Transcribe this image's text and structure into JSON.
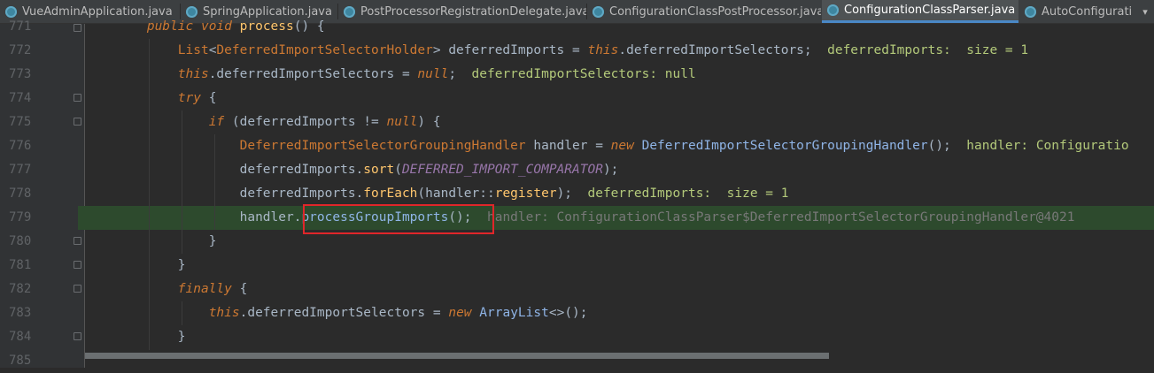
{
  "tabs": [
    {
      "label": "VueAdminApplication.java",
      "active": false,
      "closable": true
    },
    {
      "label": "SpringApplication.java",
      "active": false,
      "closable": true
    },
    {
      "label": "PostProcessorRegistrationDelegate.java",
      "active": false,
      "closable": true
    },
    {
      "label": "ConfigurationClassPostProcessor.java",
      "active": false,
      "closable": true
    },
    {
      "label": "ConfigurationClassParser.java",
      "active": true,
      "closable": true
    },
    {
      "label": "AutoConfigurati",
      "active": false,
      "closable": false
    }
  ],
  "tab_close_glyph": "×",
  "tab_overflow_glyph": "▾",
  "line_numbers": [
    "771",
    "772",
    "773",
    "774",
    "775",
    "776",
    "777",
    "778",
    "779",
    "780",
    "781",
    "782",
    "783",
    "784",
    "785"
  ],
  "code": {
    "l771": {
      "kw1": "public",
      "kw2": "void",
      "mth": "process",
      "rest": "() {"
    },
    "l772": {
      "kw": "List",
      "lt": "<",
      "type": "DeferredImportSelectorHolder",
      "gt": ">",
      "var": " deferredImports = ",
      "this": "this",
      "dot": ".",
      "fld": "deferredImportSelectors",
      "semi": ";",
      "inlay_name": "  deferredImports:",
      "inlay_size": "  size = ",
      "inlay_num": "1"
    },
    "l773": {
      "this": "this",
      "dot": ".",
      "fld": "deferredImportSelectors",
      "eq": " = ",
      "null": "null",
      "semi": ";",
      "inlay": "  deferredImportSelectors: null"
    },
    "l774": {
      "kw": "try",
      "rest": " {"
    },
    "l775": {
      "kw": "if",
      "open": " (deferredImports != ",
      "null": "null",
      "close": ") {"
    },
    "l776": {
      "type1": "DeferredImportSelectorGroupingHandler",
      "mid": " handler = ",
      "new": "new",
      "type2": " DeferredImportSelectorGroupingHandler",
      "rest": "();",
      "inlay": "  handler: Configuratio"
    },
    "l777": {
      "var": "deferredImports.",
      "mth": "sort",
      "open": "(",
      "cst": "DEFERRED_IMPORT_COMPARATOR",
      "close": ");"
    },
    "l778": {
      "var": "deferredImports.",
      "mth": "forEach",
      "open": "(handler::",
      "ref": "register",
      "close": ");",
      "inlay_name": "  deferredImports:",
      "inlay_size": "  size = ",
      "inlay_num": "1"
    },
    "l779": {
      "var": "handler.",
      "mth": "processGroupImports",
      "rest": "();",
      "inlay": "  handler: ConfigurationClassParser$DeferredImportSelectorGroupingHandler@4021"
    },
    "l780": {
      "text": "}"
    },
    "l781": {
      "text": "}"
    },
    "l782": {
      "kw": "finally",
      "rest": " {"
    },
    "l783": {
      "this": "this",
      "dot": ".",
      "fld": "deferredImportSelectors",
      "eq": " = ",
      "new": "new",
      "type": " ArrayList",
      "rest": "<>();"
    },
    "l784": {
      "text": "}"
    }
  },
  "colors": {
    "background": "#2b2b2b",
    "current_line": "#2d4a2d",
    "highlight_box": "#e0262a",
    "keyword": "#cc7832",
    "field": "#9876aa",
    "method": "#ffc66d",
    "inlay": "#b3c97a"
  }
}
